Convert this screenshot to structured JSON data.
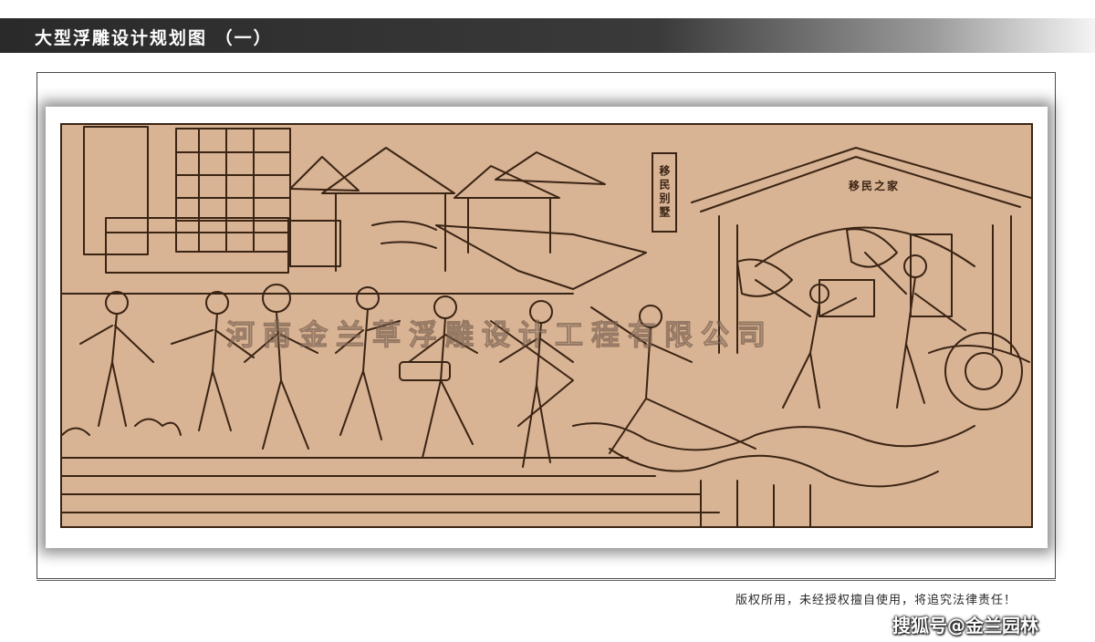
{
  "header": {
    "title": "大型浮雕设计规划图 （一）"
  },
  "relief": {
    "watermark": "河南金兰草浮雕设计工程有限公司",
    "sign_vertical": "移民别墅",
    "gate_sign": "移民之家"
  },
  "footer": {
    "copyright": "版权所用，未经授权擅自使用，将追究法律责任！",
    "source": "搜狐号@金兰园林"
  },
  "colors": {
    "relief_bg": "#d8b394",
    "line": "#3a2414",
    "title_bar": "#2a2a2a"
  }
}
